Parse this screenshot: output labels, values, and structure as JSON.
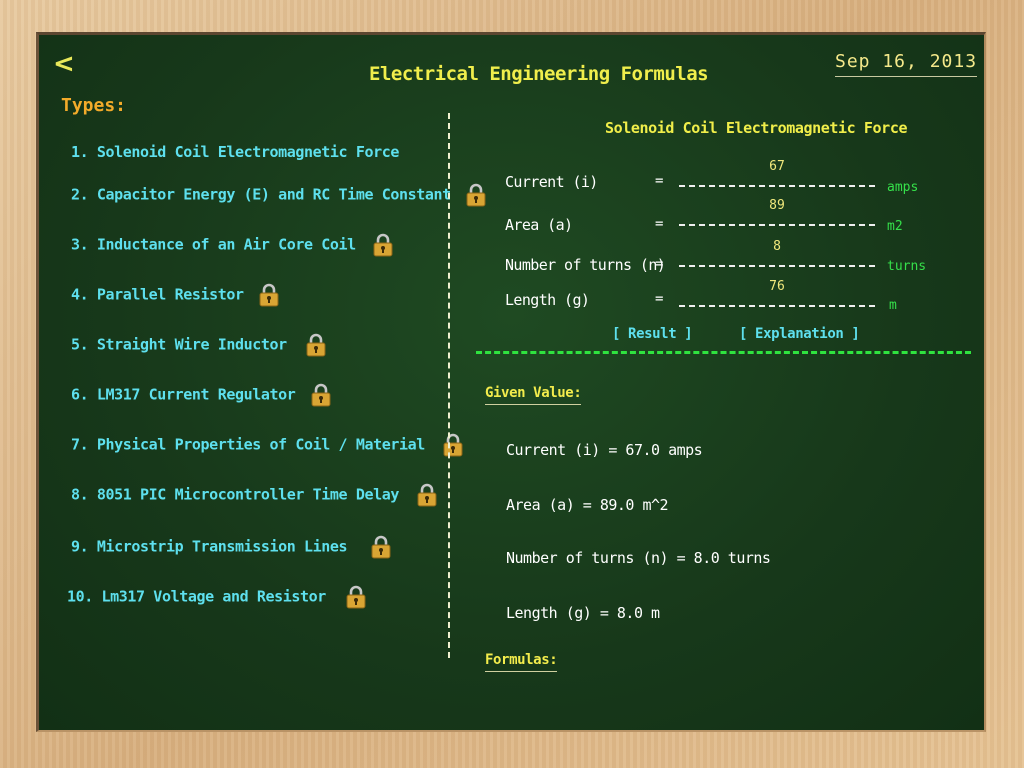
{
  "header": {
    "back_label": "<",
    "title": "Electrical Engineering Formulas",
    "date": "Sep 16, 2013"
  },
  "sidebar": {
    "heading": "Types:",
    "items": [
      {
        "label": "1. Solenoid Coil Electromagnetic Force",
        "locked": false
      },
      {
        "label": "2. Capacitor Energy (E) and RC Time Constant",
        "locked": true
      },
      {
        "label": "3. Inductance of an Air Core Coil",
        "locked": true
      },
      {
        "label": "4. Parallel Resistor",
        "locked": true
      },
      {
        "label": "5. Straight Wire Inductor",
        "locked": true
      },
      {
        "label": "6. LM317 Current Regulator",
        "locked": true
      },
      {
        "label": "7. Physical Properties of Coil / Material",
        "locked": true
      },
      {
        "label": "8. 8051 PIC Microcontroller Time Delay",
        "locked": true
      },
      {
        "label": "9. Microstrip Transmission Lines",
        "locked": true
      },
      {
        "label": "10. Lm317 Voltage and Resistor",
        "locked": true
      }
    ]
  },
  "calculator": {
    "title": "Solenoid Coil Electromagnetic Force",
    "equals": "=",
    "rows": [
      {
        "label": "Current (i)",
        "value": "67",
        "unit": "amps"
      },
      {
        "label": "Area (a)",
        "value": "89",
        "unit": "m2"
      },
      {
        "label": "Number of turns (n)",
        "value": "8",
        "unit": "turns"
      },
      {
        "label": "Length (g)",
        "value": "76",
        "unit": "m"
      }
    ],
    "result_label": "[ Result ]",
    "explanation_label": "[ Explanation ]"
  },
  "given": {
    "heading": "Given Value:",
    "lines": [
      "Current (i) = 67.0 amps",
      "Area (a) = 89.0 m^2",
      "Number of turns (n) = 8.0 turns",
      "Length (g) = 8.0 m"
    ]
  },
  "formulas": {
    "heading": "Formulas:"
  },
  "colors": {
    "board": "#17381a",
    "title": "#f0ee4c",
    "list": "#5ee0ee",
    "heading": "#f3ab2a",
    "unit": "#35e04a"
  }
}
